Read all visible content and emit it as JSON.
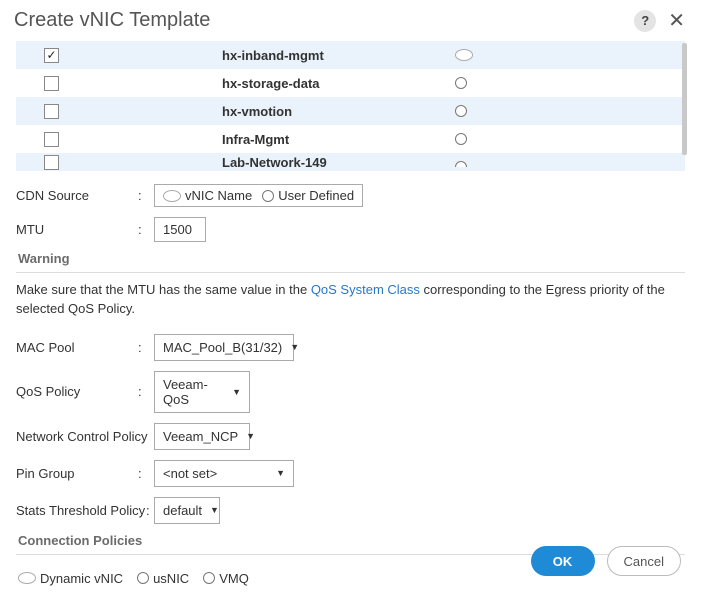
{
  "header": {
    "title": "Create vNIC Template",
    "help": "?"
  },
  "vlans": [
    {
      "name": "hx-inband-mgmt",
      "checked": true,
      "native": true
    },
    {
      "name": "hx-storage-data",
      "checked": false,
      "native": false
    },
    {
      "name": "hx-vmotion",
      "checked": false,
      "native": false
    },
    {
      "name": "Infra-Mgmt",
      "checked": false,
      "native": false
    },
    {
      "name": "Lab-Network-149",
      "checked": false,
      "native": false
    }
  ],
  "cdn": {
    "label": "CDN Source",
    "options": {
      "vnic": "vNIC Name",
      "user": "User Defined"
    },
    "selected": "vnic"
  },
  "mtu": {
    "label": "MTU",
    "value": "1500"
  },
  "warning": {
    "heading": "Warning",
    "pre": "Make sure that the MTU has the same value in the ",
    "link": "QoS System Class",
    "post": " corresponding to the Egress priority of the selected QoS Policy."
  },
  "fields": {
    "mac_pool": {
      "label": "MAC Pool",
      "value": "MAC_Pool_B(31/32)"
    },
    "qos": {
      "label": "QoS Policy",
      "value": "Veeam-QoS"
    },
    "ncp": {
      "label": "Network Control Policy",
      "value": "Veeam_NCP"
    },
    "pin": {
      "label": "Pin Group",
      "value": "<not set>"
    },
    "stats": {
      "label": "Stats Threshold Policy",
      "value": "default"
    }
  },
  "connection": {
    "heading": "Connection Policies",
    "options": {
      "dynamic": "Dynamic vNIC",
      "usnic": "usNIC",
      "vmq": "VMQ"
    },
    "selected": "dynamic"
  },
  "buttons": {
    "ok": "OK",
    "cancel": "Cancel"
  }
}
